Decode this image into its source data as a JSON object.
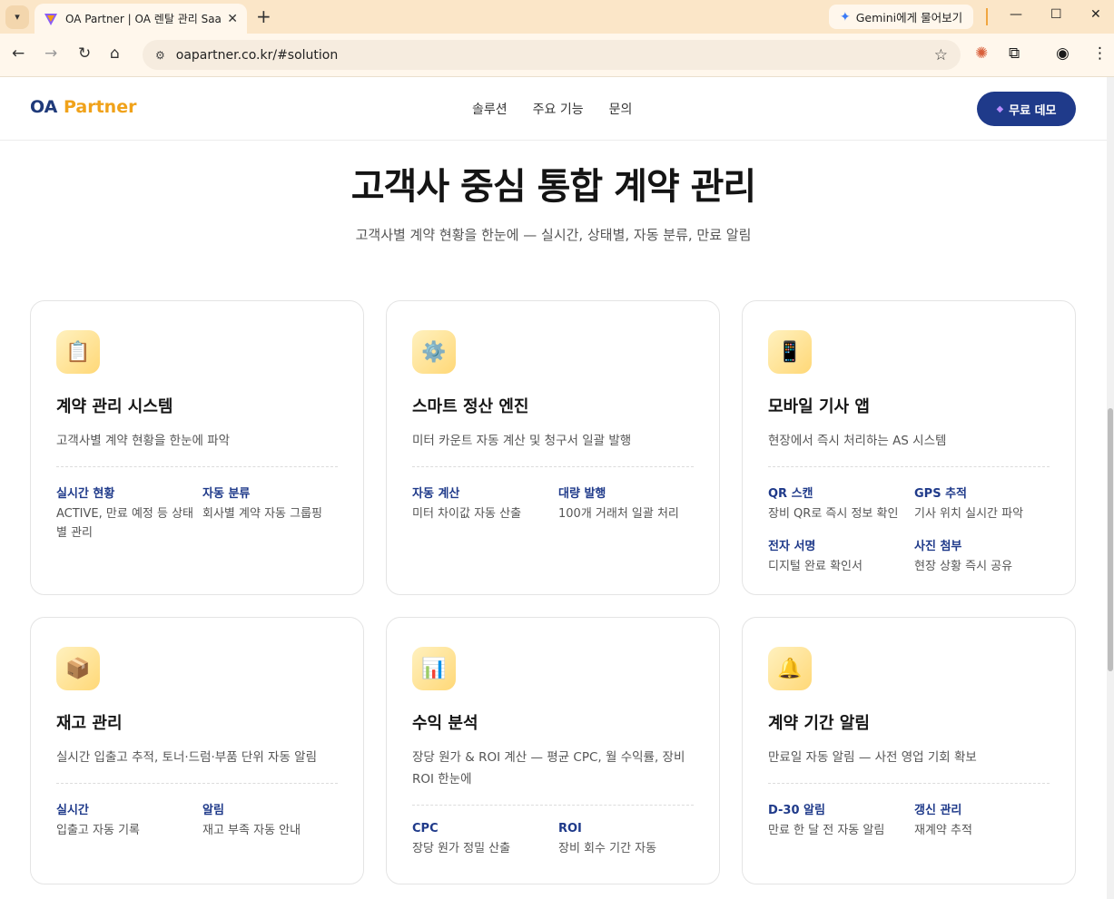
{
  "browser": {
    "tab_title": "OA Partner | OA 렌탈 관리 Saa",
    "url": "oapartner.co.kr/#solution",
    "gemini_label": "Gemini에게 물어보기"
  },
  "header": {
    "brand_oa": "OA",
    "brand_partner": "Partner",
    "menu": [
      "솔루션",
      "주요 기능",
      "문의"
    ],
    "demo_label": "무료 데모"
  },
  "hero": {
    "title": "고객사 중심 통합 계약 관리",
    "subtitle": "고객사별 계약 현황을 한눈에 — 실시간, 상태별, 자동 분류, 만료 알림"
  },
  "cards": [
    {
      "icon": "clipboard-icon",
      "glyph": "📋",
      "title": "계약 관리 시스템",
      "desc": "고객사별 계약 현황을 한눈에 파악",
      "features": [
        {
          "name": "실시간 현황",
          "desc": "ACTIVE, 만료 예정 등 상태별 관리"
        },
        {
          "name": "자동 분류",
          "desc": "회사별 계약 자동 그룹핑"
        }
      ]
    },
    {
      "icon": "gear-icon",
      "glyph": "⚙️",
      "title": "스마트 정산 엔진",
      "desc": "미터 카운트 자동 계산 및 청구서 일괄 발행",
      "features": [
        {
          "name": "자동 계산",
          "desc": "미터 차이값 자동 산출"
        },
        {
          "name": "대량 발행",
          "desc": "100개 거래처 일괄 처리"
        }
      ]
    },
    {
      "icon": "phone-app-icon",
      "glyph": "📱",
      "title": "모바일 기사 앱",
      "desc": "현장에서 즉시 처리하는 AS 시스템",
      "features": [
        {
          "name": "QR 스캔",
          "desc": "장비 QR로 즉시 정보 확인"
        },
        {
          "name": "GPS 추적",
          "desc": "기사 위치 실시간 파악"
        },
        {
          "name": "전자 서명",
          "desc": "디지털 완료 확인서"
        },
        {
          "name": "사진 첨부",
          "desc": "현장 상황 즉시 공유"
        }
      ]
    },
    {
      "icon": "package-icon",
      "glyph": "📦",
      "title": "재고 관리",
      "desc": "실시간 입출고 추적, 토너·드럼·부품 단위 자동 알림",
      "features": [
        {
          "name": "실시간",
          "desc": "입출고 자동 기록"
        },
        {
          "name": "알림",
          "desc": "재고 부족 자동 안내"
        }
      ]
    },
    {
      "icon": "bar-chart-icon",
      "glyph": "📊",
      "title": "수익 분석",
      "desc": "장당 원가 & ROI 계산 — 평균 CPC, 월 수익률, 장비 ROI 한눈에",
      "features": [
        {
          "name": "CPC",
          "desc": "장당 원가 정밀 산출"
        },
        {
          "name": "ROI",
          "desc": "장비 회수 기간 자동"
        }
      ]
    },
    {
      "icon": "bell-icon",
      "glyph": "🔔",
      "title": "계약 기간 알림",
      "desc": "만료일 자동 알림 — 사전 영업 기회 확보",
      "features": [
        {
          "name": "D-30 알림",
          "desc": "만료 한 달 전 자동 알림"
        },
        {
          "name": "갱신 관리",
          "desc": "재계약 추적"
        }
      ]
    }
  ]
}
